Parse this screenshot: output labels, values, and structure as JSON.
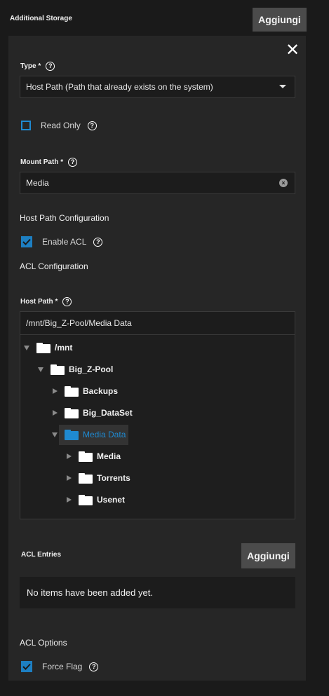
{
  "section": {
    "title": "Additional Storage",
    "add_label": "Aggiungi"
  },
  "form": {
    "type": {
      "label": "Type *",
      "value": "Host Path (Path that already exists on the system)"
    },
    "read_only": {
      "label": "Read Only",
      "checked": false
    },
    "mount_path": {
      "label": "Mount Path *",
      "value": "Media"
    },
    "host_path_config": {
      "heading": "Host Path Configuration"
    },
    "enable_acl": {
      "label": "Enable ACL",
      "checked": true
    },
    "acl_config": {
      "heading": "ACL Configuration"
    },
    "host_path": {
      "label": "Host Path *",
      "value": "/mnt/Big_Z-Pool/Media Data"
    },
    "tree": [
      {
        "label": "/mnt",
        "expanded": true
      },
      {
        "label": "Big_Z-Pool",
        "expanded": true
      },
      {
        "label": "Backups",
        "expanded": false
      },
      {
        "label": "Big_DataSet",
        "expanded": false
      },
      {
        "label": "Media Data",
        "expanded": true,
        "selected": true
      },
      {
        "label": "Media",
        "expanded": false
      },
      {
        "label": "Torrents",
        "expanded": false
      },
      {
        "label": "Usenet",
        "expanded": false
      }
    ],
    "acl_entries": {
      "label": "ACL Entries",
      "add_label": "Aggiungi",
      "empty_text": "No items have been added yet."
    },
    "acl_options": {
      "heading": "ACL Options"
    },
    "force_flag": {
      "label": "Force Flag",
      "checked": true
    }
  },
  "colors": {
    "accent": "#1f8ad1",
    "background": "#1a1a1a",
    "panel": "#262626",
    "button": "#4b4b4b"
  }
}
